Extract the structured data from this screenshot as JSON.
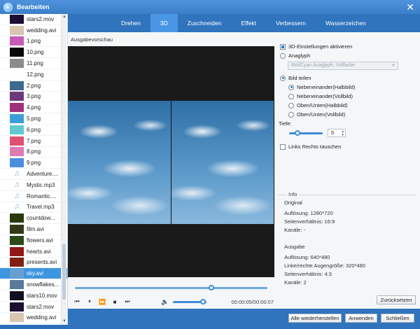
{
  "window": {
    "title": "Bearbeiten",
    "close_glyph": "✕"
  },
  "tabs": [
    "Drehen",
    "3D",
    "Zuschneiden",
    "Effekt",
    "Verbessern",
    "Wasserzeichen"
  ],
  "active_tab": "3D",
  "files": [
    {
      "label": "stars2.mov",
      "thumb": "#1a1030"
    },
    {
      "label": "wedding.avi",
      "thumb": "#d8c6b0"
    },
    {
      "label": "1.png",
      "thumb": "#c85bb8"
    },
    {
      "label": "10.png",
      "thumb": "#080808"
    },
    {
      "label": "11.png",
      "thumb": "#8c8c8c"
    },
    {
      "label": "12.png",
      "thumb": "#ffffff"
    },
    {
      "label": "2.png",
      "thumb": "#3d6a8e"
    },
    {
      "label": "3.png",
      "thumb": "#6b3a7a"
    },
    {
      "label": "4.png",
      "thumb": "#a0307a"
    },
    {
      "label": "5.png",
      "thumb": "#3a9ed8"
    },
    {
      "label": "6.png",
      "thumb": "#5ec9cf"
    },
    {
      "label": "7.png",
      "thumb": "#e05070"
    },
    {
      "label": "8.png",
      "thumb": "#e07ab0"
    },
    {
      "label": "9.png",
      "thumb": "#4a8ee0"
    },
    {
      "label": "Adventure....",
      "thumb": "note"
    },
    {
      "label": "Mystic.mp3",
      "thumb": "note"
    },
    {
      "label": "Romantic....",
      "thumb": "note"
    },
    {
      "label": "Travel.mp3",
      "thumb": "note"
    },
    {
      "label": "countdow...",
      "thumb": "#2a3a10"
    },
    {
      "label": "film.avi",
      "thumb": "#303818"
    },
    {
      "label": "flowers.avi",
      "thumb": "#2a4a18"
    },
    {
      "label": "hearts.avi",
      "thumb": "#901818"
    },
    {
      "label": "presents.avi",
      "thumb": "#802010"
    },
    {
      "label": "sky.avi",
      "thumb": "#6aa0d0",
      "selected": true
    },
    {
      "label": "snowflakes...",
      "thumb": "#5a7a9a"
    },
    {
      "label": "stars10.mov",
      "thumb": "#101020"
    },
    {
      "label": "stars2.mov",
      "thumb": "#1a1030"
    },
    {
      "label": "wedding.avi",
      "thumb": "#d8c6b0"
    }
  ],
  "preview": {
    "label": "Ausgabevorschau",
    "progress": 0.71,
    "volume": 0.9,
    "time": "00:00:05/00:00:07"
  },
  "settings": {
    "enable_3d": "3D-Einstellungen aktivieren",
    "anaglyph": "Anaglyph",
    "anaglyph_select": "Rot/Cyan Anaglyph, Vollfarbe",
    "split": "Bild teilen",
    "split_options": [
      "Nebeneinander(Halbbild)",
      "Nebeneinander(Vollbild)",
      "Oben/Unten(Halbbild)",
      "Oben/Unten(Vollbild)"
    ],
    "depth_label": "Tiefe:",
    "depth_value": "5",
    "depth_fraction": 0.25,
    "swap": "Links Rechts tauschen"
  },
  "info": {
    "title": "Info",
    "original_heading": "Original",
    "original": [
      "Auflösung: 1280*720",
      "Seitenverhältnis: 16:9",
      "Kanäle: -"
    ],
    "output_heading": "Ausgabe",
    "output": [
      "Auflösung: 640*480",
      "Linke/rechte Augengröße: 320*480",
      "Seitenverhältnis: 4:3",
      "Kanäle: 2"
    ]
  },
  "buttons": {
    "reset": "Zurücksetzen",
    "restore_all": "Alle wiederherstellen",
    "apply": "Anwenden",
    "close": "Schließen"
  }
}
